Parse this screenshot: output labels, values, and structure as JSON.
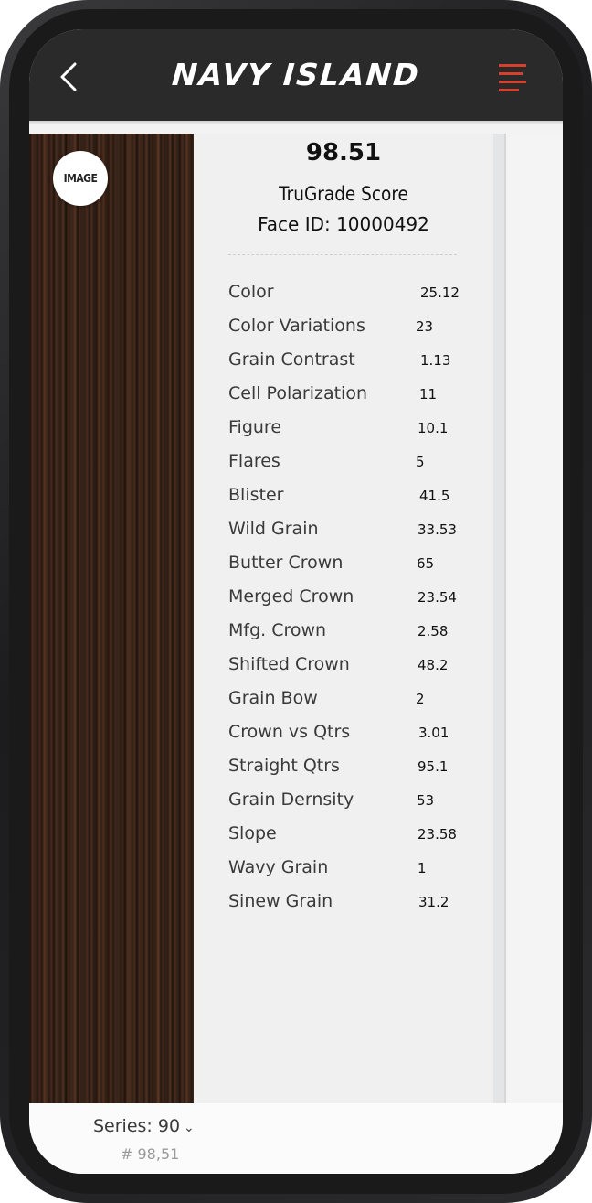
{
  "header": {
    "logo_text": "NAVY ISLAND",
    "back_icon": "chevron-left-icon",
    "menu_icon": "hamburger-menu-icon",
    "accent_color": "#d7402a"
  },
  "image_badge": {
    "label": "IMAGE"
  },
  "score": {
    "value": "98.51",
    "label": "TruGrade Score",
    "face_id": "Face ID: 10000492"
  },
  "metrics": [
    {
      "label": "Color",
      "value": "25.12"
    },
    {
      "label": "Color Variations",
      "value": "23"
    },
    {
      "label": "Grain Contrast",
      "value": "1.13"
    },
    {
      "label": "Cell Polarization",
      "value": "11"
    },
    {
      "label": "Figure",
      "value": "10.1"
    },
    {
      "label": "Flares",
      "value": "5"
    },
    {
      "label": "Blister",
      "value": "41.5"
    },
    {
      "label": "Wild Grain",
      "value": "33.53"
    },
    {
      "label": "Butter Crown",
      "value": "65"
    },
    {
      "label": "Merged Crown",
      "value": "23.54"
    },
    {
      "label": "Mfg. Crown",
      "value": "2.58"
    },
    {
      "label": "Shifted Crown",
      "value": "48.2"
    },
    {
      "label": "Grain Bow",
      "value": "2"
    },
    {
      "label": "Crown vs Qtrs",
      "value": "3.01"
    },
    {
      "label": "Straight Qtrs",
      "value": "95.1"
    },
    {
      "label": "Grain Dernsity",
      "value": "53"
    },
    {
      "label": "Slope",
      "value": "23.58"
    },
    {
      "label": "Wavy Grain",
      "value": "1"
    },
    {
      "label": "Sinew Grain",
      "value": "31.2"
    }
  ],
  "footer": {
    "series_label": "Series: 90",
    "series_icon": "chevron-down-icon",
    "sub_label": "# 98,51"
  }
}
